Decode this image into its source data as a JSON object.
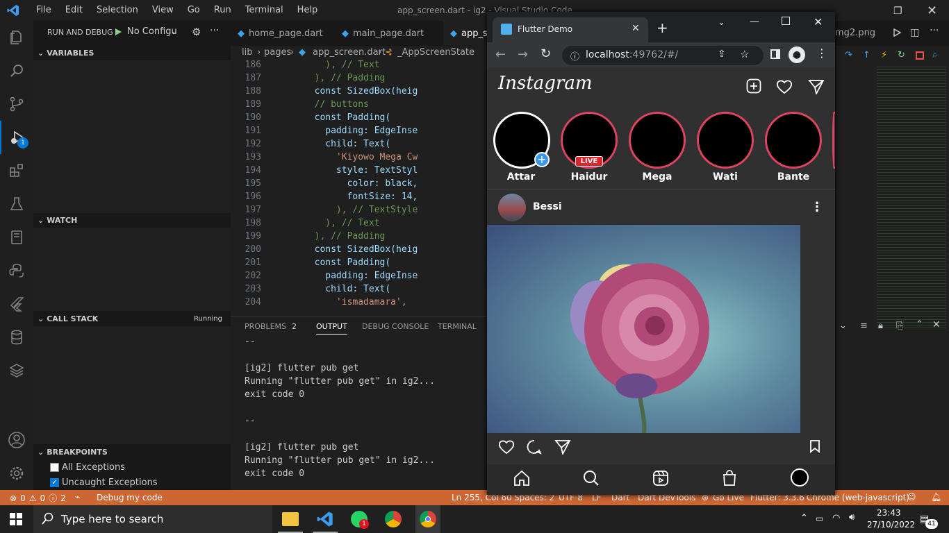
{
  "window_title": "app_screen.dart - ig2 - Visual Studio Code",
  "menu": [
    "File",
    "Edit",
    "Selection",
    "View",
    "Go",
    "Run",
    "Terminal",
    "Help"
  ],
  "activity_badge": "1",
  "sidebar": {
    "header": "RUN AND DEBUG",
    "config": "No Configu",
    "sections": {
      "variables": "VARIABLES",
      "watch": "WATCH",
      "call_stack": "CALL STACK",
      "call_stack_status": "Running",
      "breakpoints": "BREAKPOINTS"
    },
    "breakpoints": [
      {
        "label": "All Exceptions",
        "checked": false
      },
      {
        "label": "Uncaught Exceptions",
        "checked": true
      }
    ]
  },
  "tabs": [
    "home_page.dart",
    "main_page.dart",
    "app_s"
  ],
  "right_tab": "mg2.png",
  "breadcrumb": {
    "a": "lib",
    "b": "pages",
    "c": "app_screen.dart",
    "d": "_AppScreenState"
  },
  "code": [
    {
      "n": "186",
      "t": "          ), // Text"
    },
    {
      "n": "187",
      "t": "        ), // Padding"
    },
    {
      "n": "188",
      "t": "        const SizedBox(heig"
    },
    {
      "n": "189",
      "t": "        // buttons"
    },
    {
      "n": "190",
      "t": "        const Padding("
    },
    {
      "n": "191",
      "t": "          padding: EdgeInse"
    },
    {
      "n": "192",
      "t": "          child: Text("
    },
    {
      "n": "193",
      "t": "            'Kiyowo Mega Cw"
    },
    {
      "n": "194",
      "t": "            style: TextStyl"
    },
    {
      "n": "195",
      "t": "              color: black,"
    },
    {
      "n": "196",
      "t": "              fontSize: 14,"
    },
    {
      "n": "197",
      "t": "            ), // TextStyle"
    },
    {
      "n": "198",
      "t": "          ), // Text"
    },
    {
      "n": "199",
      "t": "        ), // Padding"
    },
    {
      "n": "200",
      "t": "        const SizedBox(heig"
    },
    {
      "n": "201",
      "t": "        const Padding("
    },
    {
      "n": "202",
      "t": "          padding: EdgeInse"
    },
    {
      "n": "203",
      "t": "          child: Text("
    },
    {
      "n": "204",
      "t": "            'ismadamara',"
    }
  ],
  "panel": {
    "tabs": {
      "problems": "PROBLEMS",
      "problems_count": "2",
      "output": "OUTPUT",
      "debug": "DEBUG CONSOLE",
      "terminal": "TERMINAL"
    },
    "lines": [
      "--",
      "",
      "[ig2] flutter pub get",
      "Running \"flutter pub get\" in ig2...",
      "exit code 0",
      "",
      "--",
      "",
      "[ig2] flutter pub get",
      "Running \"flutter pub get\" in ig2...",
      "exit code 0"
    ]
  },
  "status": {
    "errors": "0",
    "warnings": "0",
    "info": "2",
    "debug": "Debug my code",
    "position": "Ln 255, Col 60",
    "spaces": "Spaces: 2",
    "encoding": "UTF-8",
    "eol": "LF",
    "lang": "Dart",
    "devtools": "Dart DevTools",
    "golive": "Go Live",
    "flutter": "Flutter: 3.3.6",
    "device": "Chrome (web-javascript)"
  },
  "taskbar": {
    "search": "Type here to search",
    "time": "23:43",
    "date": "27/10/2022",
    "notif": "41",
    "whatsapp_badge": "1"
  },
  "browser": {
    "tab_title": "Flutter Demo",
    "url_host": "localhost",
    "url_rest": ":49762/#/",
    "app_title": "Instagram",
    "stories": [
      {
        "name": "Attar",
        "live": ""
      },
      {
        "name": "Haidur",
        "live": "LIVE"
      },
      {
        "name": "Mega",
        "live": ""
      },
      {
        "name": "Wati",
        "live": ""
      },
      {
        "name": "Bante",
        "live": ""
      }
    ],
    "post_user": "Bessi"
  },
  "colors": {
    "accent": "#0078d4",
    "statusbar": "#cc6633",
    "story_ring": "#e0435f",
    "live": "#e0242e"
  }
}
